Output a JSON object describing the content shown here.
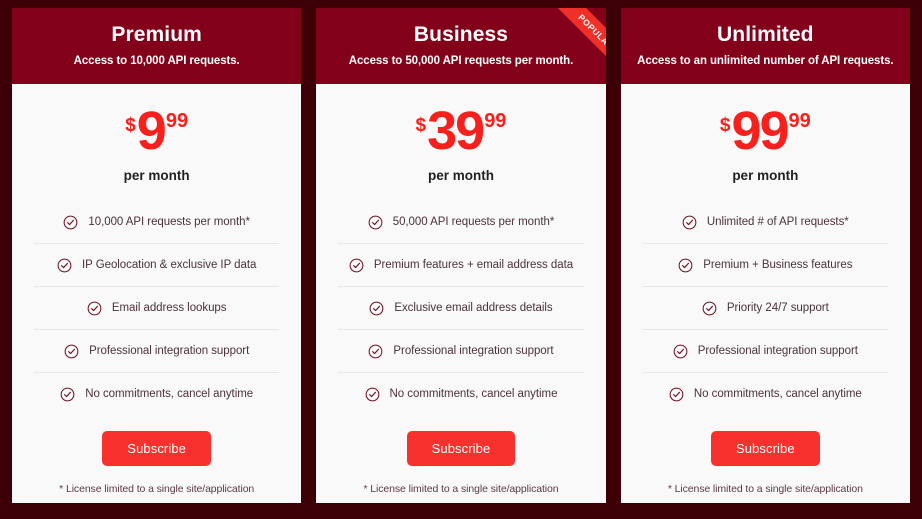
{
  "theme": {
    "page_background": "#3d0007",
    "card_background": "#faf9fa",
    "header_background": "#820019",
    "accent_red": "#f8201c",
    "button_red": "#f8312f",
    "ribbon_red": "#f03028",
    "feature_text": "#4a3238",
    "divider": "#e9e6e8"
  },
  "plans": [
    {
      "name": "Premium",
      "subtitle": "Access to 10,000 API requests.",
      "badge": null,
      "currency": "$",
      "price": "9",
      "cents": "99",
      "period": "per month",
      "features": [
        "10,000 API requests per month*",
        "IP Geolocation & exclusive IP data",
        "Email address lookups",
        "Professional integration support",
        "No commitments, cancel anytime"
      ],
      "cta": "Subscribe",
      "footnote": "* License limited to a single site/application"
    },
    {
      "name": "Business",
      "subtitle": "Access to 50,000 API requests per month.",
      "badge": "POPULAR",
      "currency": "$",
      "price": "39",
      "cents": "99",
      "period": "per month",
      "features": [
        "50,000 API requests per month*",
        "Premium features + email address data",
        "Exclusive email address details",
        "Professional integration support",
        "No commitments, cancel anytime"
      ],
      "cta": "Subscribe",
      "footnote": "* License limited to a single site/application"
    },
    {
      "name": "Unlimited",
      "subtitle": "Access to an unlimited number of API requests.",
      "badge": null,
      "currency": "$",
      "price": "99",
      "cents": "99",
      "period": "per month",
      "features": [
        "Unlimited # of API requests*",
        "Premium + Business features",
        "Priority 24/7 support",
        "Professional integration support",
        "No commitments, cancel anytime"
      ],
      "cta": "Subscribe",
      "footnote": "* License limited to a single site/application"
    }
  ],
  "icons": {
    "feature_check": "check-circle-icon"
  }
}
